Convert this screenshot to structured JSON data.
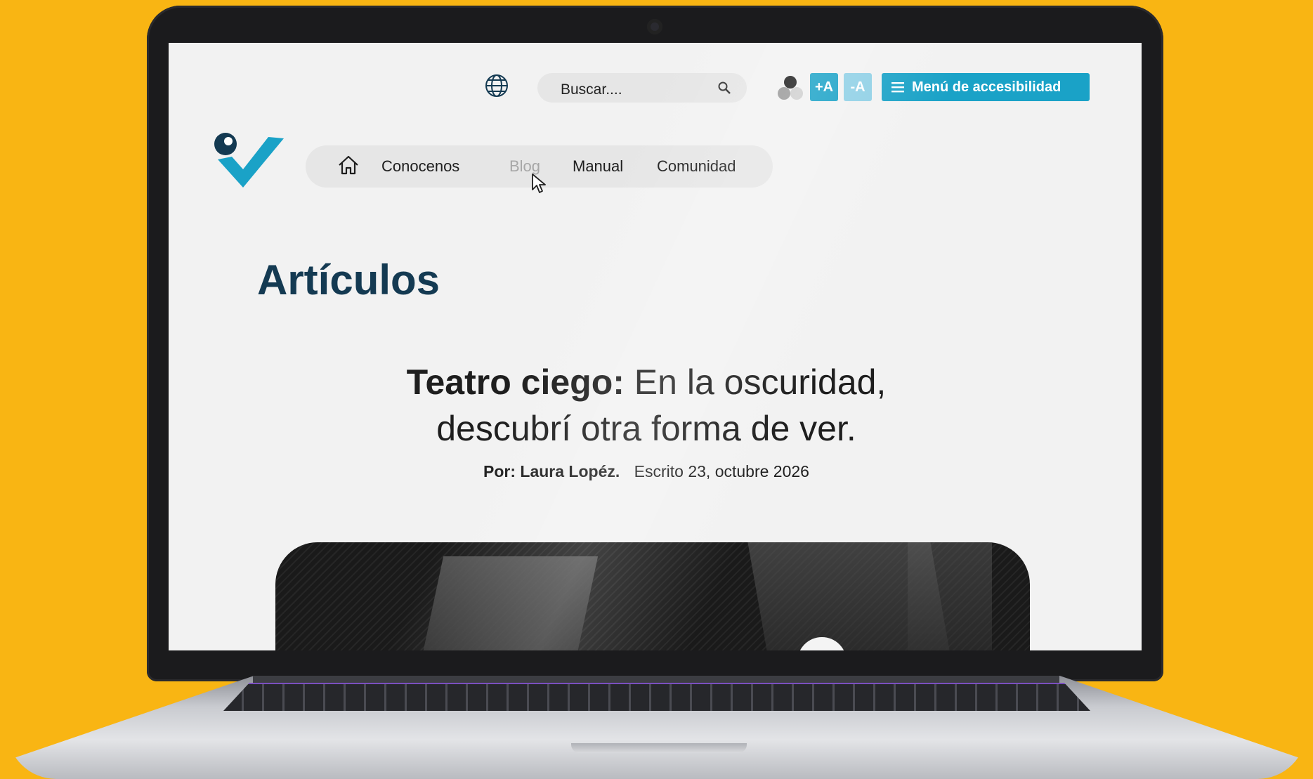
{
  "colors": {
    "background": "#F9B513",
    "accent": "#1aa2c7",
    "accent_light": "#8fd0e6",
    "title": "#143a52",
    "logo_dark": "#143a52"
  },
  "header": {
    "language_icon": "globe-icon",
    "search": {
      "placeholder": "Buscar....",
      "icon": "search-icon"
    },
    "contrast_icon": "contrast-dots-icon",
    "font_increase_label": "+A",
    "font_decrease_label": "-A",
    "accessibility_menu": {
      "icon": "hamburger-icon",
      "label": "Menú de accesibilidad"
    }
  },
  "nav": {
    "home_icon": "home-icon",
    "items": [
      {
        "label": "Conocenos"
      },
      {
        "label": "Blog"
      },
      {
        "label": "Manual"
      },
      {
        "label": "Comunidad"
      }
    ]
  },
  "page": {
    "title": "Artículos"
  },
  "article": {
    "title_bold": "Teatro ciego:",
    "title_rest": " En la oscuridad, descubrí otra forma de ver.",
    "author": "Por: Laura Lopéz.",
    "date": "Escrito 23, octubre 2026"
  }
}
